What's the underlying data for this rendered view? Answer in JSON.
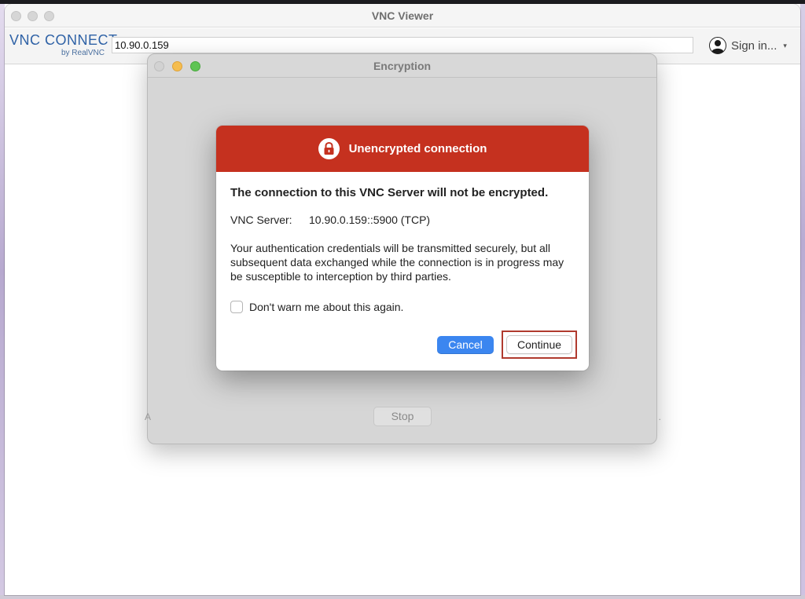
{
  "window": {
    "title": "VNC Viewer"
  },
  "toolbar": {
    "logo_text": "VNC CONNECT",
    "logo_sub": "by RealVNC",
    "address_value": "10.90.0.159",
    "signin_label": "Sign in...",
    "signin_caret": "▾"
  },
  "encryption_window": {
    "title": "Encryption",
    "stop_label": "Stop",
    "edge_left": "A",
    "edge_right": "."
  },
  "alert": {
    "title": "Unencrypted connection",
    "headline": "The connection to this VNC Server will not be encrypted.",
    "server_label": "VNC Server:",
    "server_value": "10.90.0.159::5900 (TCP)",
    "description": "Your authentication credentials will be transmitted securely, but all subsequent data exchanged while the connection is in progress may be susceptible to interception by third parties.",
    "checkbox_label": "Don't warn me about this again.",
    "checkbox_checked": false,
    "cancel_label": "Cancel",
    "continue_label": "Continue"
  },
  "icons": {
    "lock": "lock-icon",
    "user": "user-avatar-icon"
  },
  "colors": {
    "alert_header": "#c5311f",
    "cancel_button": "#3b86f0",
    "highlight_outline": "#b03a2e",
    "logo_blue": "#2f62a6"
  }
}
